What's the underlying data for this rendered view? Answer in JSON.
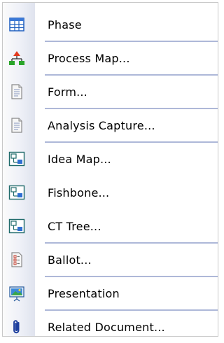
{
  "menu": {
    "items": [
      {
        "label": "Phase",
        "icon": "phase-table-icon"
      },
      {
        "label": "Process Map...",
        "icon": "process-map-icon"
      },
      {
        "label": "Form...",
        "icon": "form-document-icon"
      },
      {
        "label": "Analysis Capture...",
        "icon": "analysis-capture-document-icon"
      },
      {
        "label": "Idea Map...",
        "icon": "idea-map-icon"
      },
      {
        "label": "Fishbone...",
        "icon": "fishbone-icon"
      },
      {
        "label": "CT Tree...",
        "icon": "ct-tree-icon"
      },
      {
        "label": "Ballot...",
        "icon": "ballot-icon"
      },
      {
        "label": "Presentation",
        "icon": "presentation-icon"
      },
      {
        "label": "Related Document...",
        "icon": "paperclip-icon"
      }
    ]
  },
  "colors": {
    "separator": "#aeb8d8",
    "gutter": "#dfe3ee",
    "border": "#c9c9c9"
  }
}
